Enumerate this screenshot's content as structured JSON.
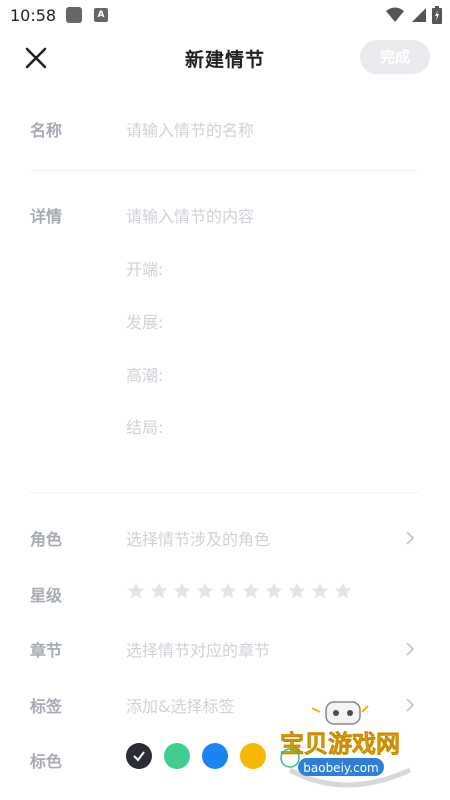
{
  "status_bar": {
    "time": "10:58"
  },
  "header": {
    "title": "新建情节",
    "done_label": "完成"
  },
  "form": {
    "name": {
      "label": "名称",
      "placeholder": "请输入情节的名称"
    },
    "detail": {
      "label": "详情",
      "placeholder": "请输入情节的内容",
      "sub_fields": [
        "开端:",
        "发展:",
        "高潮:",
        "结局:"
      ]
    },
    "role": {
      "label": "角色",
      "placeholder": "选择情节涉及的角色"
    },
    "stars": {
      "label": "星级",
      "count": 10,
      "rating": 0
    },
    "chapter": {
      "label": "章节",
      "placeholder": "选择情节对应的章节"
    },
    "tags": {
      "label": "标签",
      "placeholder": "添加&选择标签"
    },
    "mark_color": {
      "label": "标色",
      "colors": [
        "#2a2d38",
        "#3ecf8e",
        "#1a84f2",
        "#f6b800"
      ],
      "selected_index": 0
    }
  },
  "watermark": {
    "title": "宝贝游戏网",
    "url": "baobeiy.com"
  }
}
